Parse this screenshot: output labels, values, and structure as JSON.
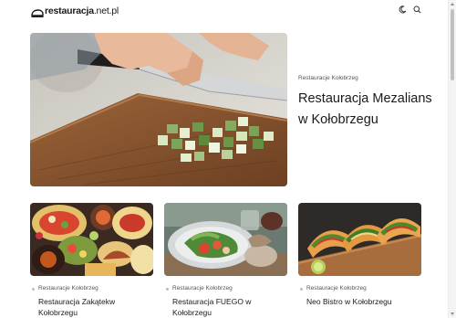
{
  "header": {
    "logo_bold": "restauracja",
    "logo_rest": ".net.pl",
    "icons": [
      "moon-icon",
      "search-icon"
    ]
  },
  "hero": {
    "category": "Restauracje Kołobrzeg",
    "title": "Restauracja Mezalians w Kołobrzegu"
  },
  "cards": [
    {
      "category": "Restauracje Kołobrzeg",
      "title": "Restauracja Zakątekw Kołobrzegu"
    },
    {
      "category": "Restauracje Kołobrzeg",
      "title": "Restauracja FUEGO w Kołobrzegu"
    },
    {
      "category": "Restauracje Kołobrzeg",
      "title": "Neo Bistro w Kołobrzegu"
    }
  ]
}
